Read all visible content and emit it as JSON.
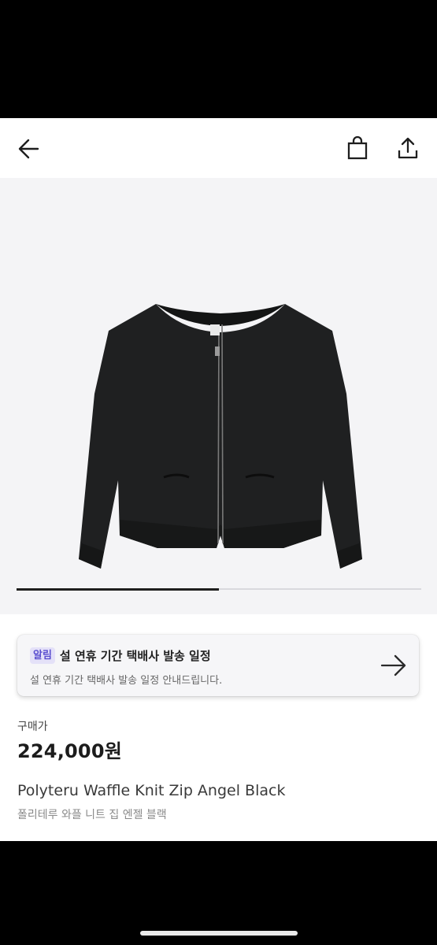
{
  "header": {
    "back_icon": "arrow-left-icon",
    "bag_icon": "shopping-bag-icon",
    "share_icon": "share-icon"
  },
  "gallery": {
    "image": "black zip-up cardigan on light grey background",
    "progress": 0.5
  },
  "notice": {
    "badge": "알림",
    "title": "설 연휴 기간 택배사 발송 일정",
    "description": "설 연휴 기간 택배사 발송 일정 안내드립니다.",
    "arrow_icon": "arrow-right-icon"
  },
  "product": {
    "price_label": "구매가",
    "price": "224,000원",
    "name_en": "Polyteru Waffle Knit Zip Angel Black",
    "name_ko": "폴리테루 와플 니트 집 엔젤 블랙"
  },
  "colors": {
    "accent_badge_bg": "#e4e1f8",
    "accent_badge_text": "#5b4fd0",
    "background": "#ffffff"
  }
}
